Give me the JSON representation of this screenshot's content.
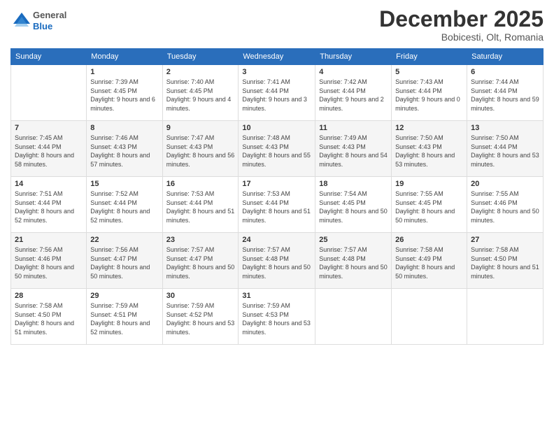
{
  "header": {
    "logo": {
      "general": "General",
      "blue": "Blue"
    },
    "month": "December 2025",
    "location": "Bobicesti, Olt, Romania"
  },
  "calendar": {
    "days_of_week": [
      "Sunday",
      "Monday",
      "Tuesday",
      "Wednesday",
      "Thursday",
      "Friday",
      "Saturday"
    ],
    "weeks": [
      [
        {
          "day": "",
          "sunrise": "",
          "sunset": "",
          "daylight": ""
        },
        {
          "day": "1",
          "sunrise": "Sunrise: 7:39 AM",
          "sunset": "Sunset: 4:45 PM",
          "daylight": "Daylight: 9 hours and 6 minutes."
        },
        {
          "day": "2",
          "sunrise": "Sunrise: 7:40 AM",
          "sunset": "Sunset: 4:45 PM",
          "daylight": "Daylight: 9 hours and 4 minutes."
        },
        {
          "day": "3",
          "sunrise": "Sunrise: 7:41 AM",
          "sunset": "Sunset: 4:44 PM",
          "daylight": "Daylight: 9 hours and 3 minutes."
        },
        {
          "day": "4",
          "sunrise": "Sunrise: 7:42 AM",
          "sunset": "Sunset: 4:44 PM",
          "daylight": "Daylight: 9 hours and 2 minutes."
        },
        {
          "day": "5",
          "sunrise": "Sunrise: 7:43 AM",
          "sunset": "Sunset: 4:44 PM",
          "daylight": "Daylight: 9 hours and 0 minutes."
        },
        {
          "day": "6",
          "sunrise": "Sunrise: 7:44 AM",
          "sunset": "Sunset: 4:44 PM",
          "daylight": "Daylight: 8 hours and 59 minutes."
        }
      ],
      [
        {
          "day": "7",
          "sunrise": "Sunrise: 7:45 AM",
          "sunset": "Sunset: 4:44 PM",
          "daylight": "Daylight: 8 hours and 58 minutes."
        },
        {
          "day": "8",
          "sunrise": "Sunrise: 7:46 AM",
          "sunset": "Sunset: 4:43 PM",
          "daylight": "Daylight: 8 hours and 57 minutes."
        },
        {
          "day": "9",
          "sunrise": "Sunrise: 7:47 AM",
          "sunset": "Sunset: 4:43 PM",
          "daylight": "Daylight: 8 hours and 56 minutes."
        },
        {
          "day": "10",
          "sunrise": "Sunrise: 7:48 AM",
          "sunset": "Sunset: 4:43 PM",
          "daylight": "Daylight: 8 hours and 55 minutes."
        },
        {
          "day": "11",
          "sunrise": "Sunrise: 7:49 AM",
          "sunset": "Sunset: 4:43 PM",
          "daylight": "Daylight: 8 hours and 54 minutes."
        },
        {
          "day": "12",
          "sunrise": "Sunrise: 7:50 AM",
          "sunset": "Sunset: 4:43 PM",
          "daylight": "Daylight: 8 hours and 53 minutes."
        },
        {
          "day": "13",
          "sunrise": "Sunrise: 7:50 AM",
          "sunset": "Sunset: 4:44 PM",
          "daylight": "Daylight: 8 hours and 53 minutes."
        }
      ],
      [
        {
          "day": "14",
          "sunrise": "Sunrise: 7:51 AM",
          "sunset": "Sunset: 4:44 PM",
          "daylight": "Daylight: 8 hours and 52 minutes."
        },
        {
          "day": "15",
          "sunrise": "Sunrise: 7:52 AM",
          "sunset": "Sunset: 4:44 PM",
          "daylight": "Daylight: 8 hours and 52 minutes."
        },
        {
          "day": "16",
          "sunrise": "Sunrise: 7:53 AM",
          "sunset": "Sunset: 4:44 PM",
          "daylight": "Daylight: 8 hours and 51 minutes."
        },
        {
          "day": "17",
          "sunrise": "Sunrise: 7:53 AM",
          "sunset": "Sunset: 4:44 PM",
          "daylight": "Daylight: 8 hours and 51 minutes."
        },
        {
          "day": "18",
          "sunrise": "Sunrise: 7:54 AM",
          "sunset": "Sunset: 4:45 PM",
          "daylight": "Daylight: 8 hours and 50 minutes."
        },
        {
          "day": "19",
          "sunrise": "Sunrise: 7:55 AM",
          "sunset": "Sunset: 4:45 PM",
          "daylight": "Daylight: 8 hours and 50 minutes."
        },
        {
          "day": "20",
          "sunrise": "Sunrise: 7:55 AM",
          "sunset": "Sunset: 4:46 PM",
          "daylight": "Daylight: 8 hours and 50 minutes."
        }
      ],
      [
        {
          "day": "21",
          "sunrise": "Sunrise: 7:56 AM",
          "sunset": "Sunset: 4:46 PM",
          "daylight": "Daylight: 8 hours and 50 minutes."
        },
        {
          "day": "22",
          "sunrise": "Sunrise: 7:56 AM",
          "sunset": "Sunset: 4:47 PM",
          "daylight": "Daylight: 8 hours and 50 minutes."
        },
        {
          "day": "23",
          "sunrise": "Sunrise: 7:57 AM",
          "sunset": "Sunset: 4:47 PM",
          "daylight": "Daylight: 8 hours and 50 minutes."
        },
        {
          "day": "24",
          "sunrise": "Sunrise: 7:57 AM",
          "sunset": "Sunset: 4:48 PM",
          "daylight": "Daylight: 8 hours and 50 minutes."
        },
        {
          "day": "25",
          "sunrise": "Sunrise: 7:57 AM",
          "sunset": "Sunset: 4:48 PM",
          "daylight": "Daylight: 8 hours and 50 minutes."
        },
        {
          "day": "26",
          "sunrise": "Sunrise: 7:58 AM",
          "sunset": "Sunset: 4:49 PM",
          "daylight": "Daylight: 8 hours and 50 minutes."
        },
        {
          "day": "27",
          "sunrise": "Sunrise: 7:58 AM",
          "sunset": "Sunset: 4:50 PM",
          "daylight": "Daylight: 8 hours and 51 minutes."
        }
      ],
      [
        {
          "day": "28",
          "sunrise": "Sunrise: 7:58 AM",
          "sunset": "Sunset: 4:50 PM",
          "daylight": "Daylight: 8 hours and 51 minutes."
        },
        {
          "day": "29",
          "sunrise": "Sunrise: 7:59 AM",
          "sunset": "Sunset: 4:51 PM",
          "daylight": "Daylight: 8 hours and 52 minutes."
        },
        {
          "day": "30",
          "sunrise": "Sunrise: 7:59 AM",
          "sunset": "Sunset: 4:52 PM",
          "daylight": "Daylight: 8 hours and 53 minutes."
        },
        {
          "day": "31",
          "sunrise": "Sunrise: 7:59 AM",
          "sunset": "Sunset: 4:53 PM",
          "daylight": "Daylight: 8 hours and 53 minutes."
        },
        {
          "day": "",
          "sunrise": "",
          "sunset": "",
          "daylight": ""
        },
        {
          "day": "",
          "sunrise": "",
          "sunset": "",
          "daylight": ""
        },
        {
          "day": "",
          "sunrise": "",
          "sunset": "",
          "daylight": ""
        }
      ]
    ]
  }
}
